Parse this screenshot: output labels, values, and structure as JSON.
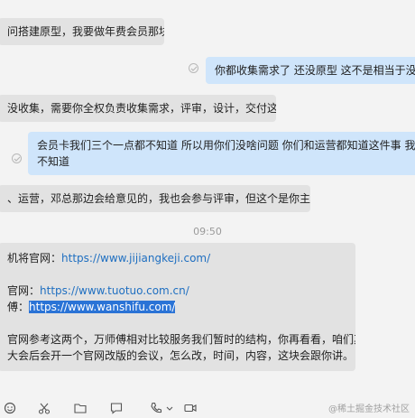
{
  "messages": [
    {
      "text": "问搭建原型，我要做年费会员那块了"
    },
    {
      "text": "你都收集需求了   还没原型  这不是相当于没说"
    },
    {
      "text": "没收集，需要你全权负责收集需求，评审，设计，交付这块。"
    },
    {
      "lines": [
        "会员卡我们三个一点都不知道   所以用你们没啥问题    你们和运营都知道这件事  我们啥",
        "不知道"
      ]
    },
    {
      "text": "、运营，邓总那边会给意见的，我也会参与评审，但这个是你主导了"
    }
  ],
  "timestamp": "09:50",
  "long_message": {
    "line1_prefix": "机将官网：",
    "line1_link": "https://www.jijiangkeji.com/",
    "line2_prefix": "官网：",
    "line2_link": "https://www.tuotuo.com.cn/",
    "line3_prefix": "傅：",
    "line3_link": "https://www.wanshifu.com/",
    "line4": "官网参考这两个，万师傅相对比较服务我们暂时的结构，你再看看，咱们其他。",
    "line5": "大会后会开一个官网改版的会议，怎么改，时间，内容，这块会跟你讲。"
  },
  "toolbar_icons": [
    "emoji-icon",
    "scissors-icon",
    "folder-icon",
    "chat-bubble-icon",
    "phone-icon",
    "video-icon"
  ],
  "watermark": "@稀土掘金技术社区"
}
